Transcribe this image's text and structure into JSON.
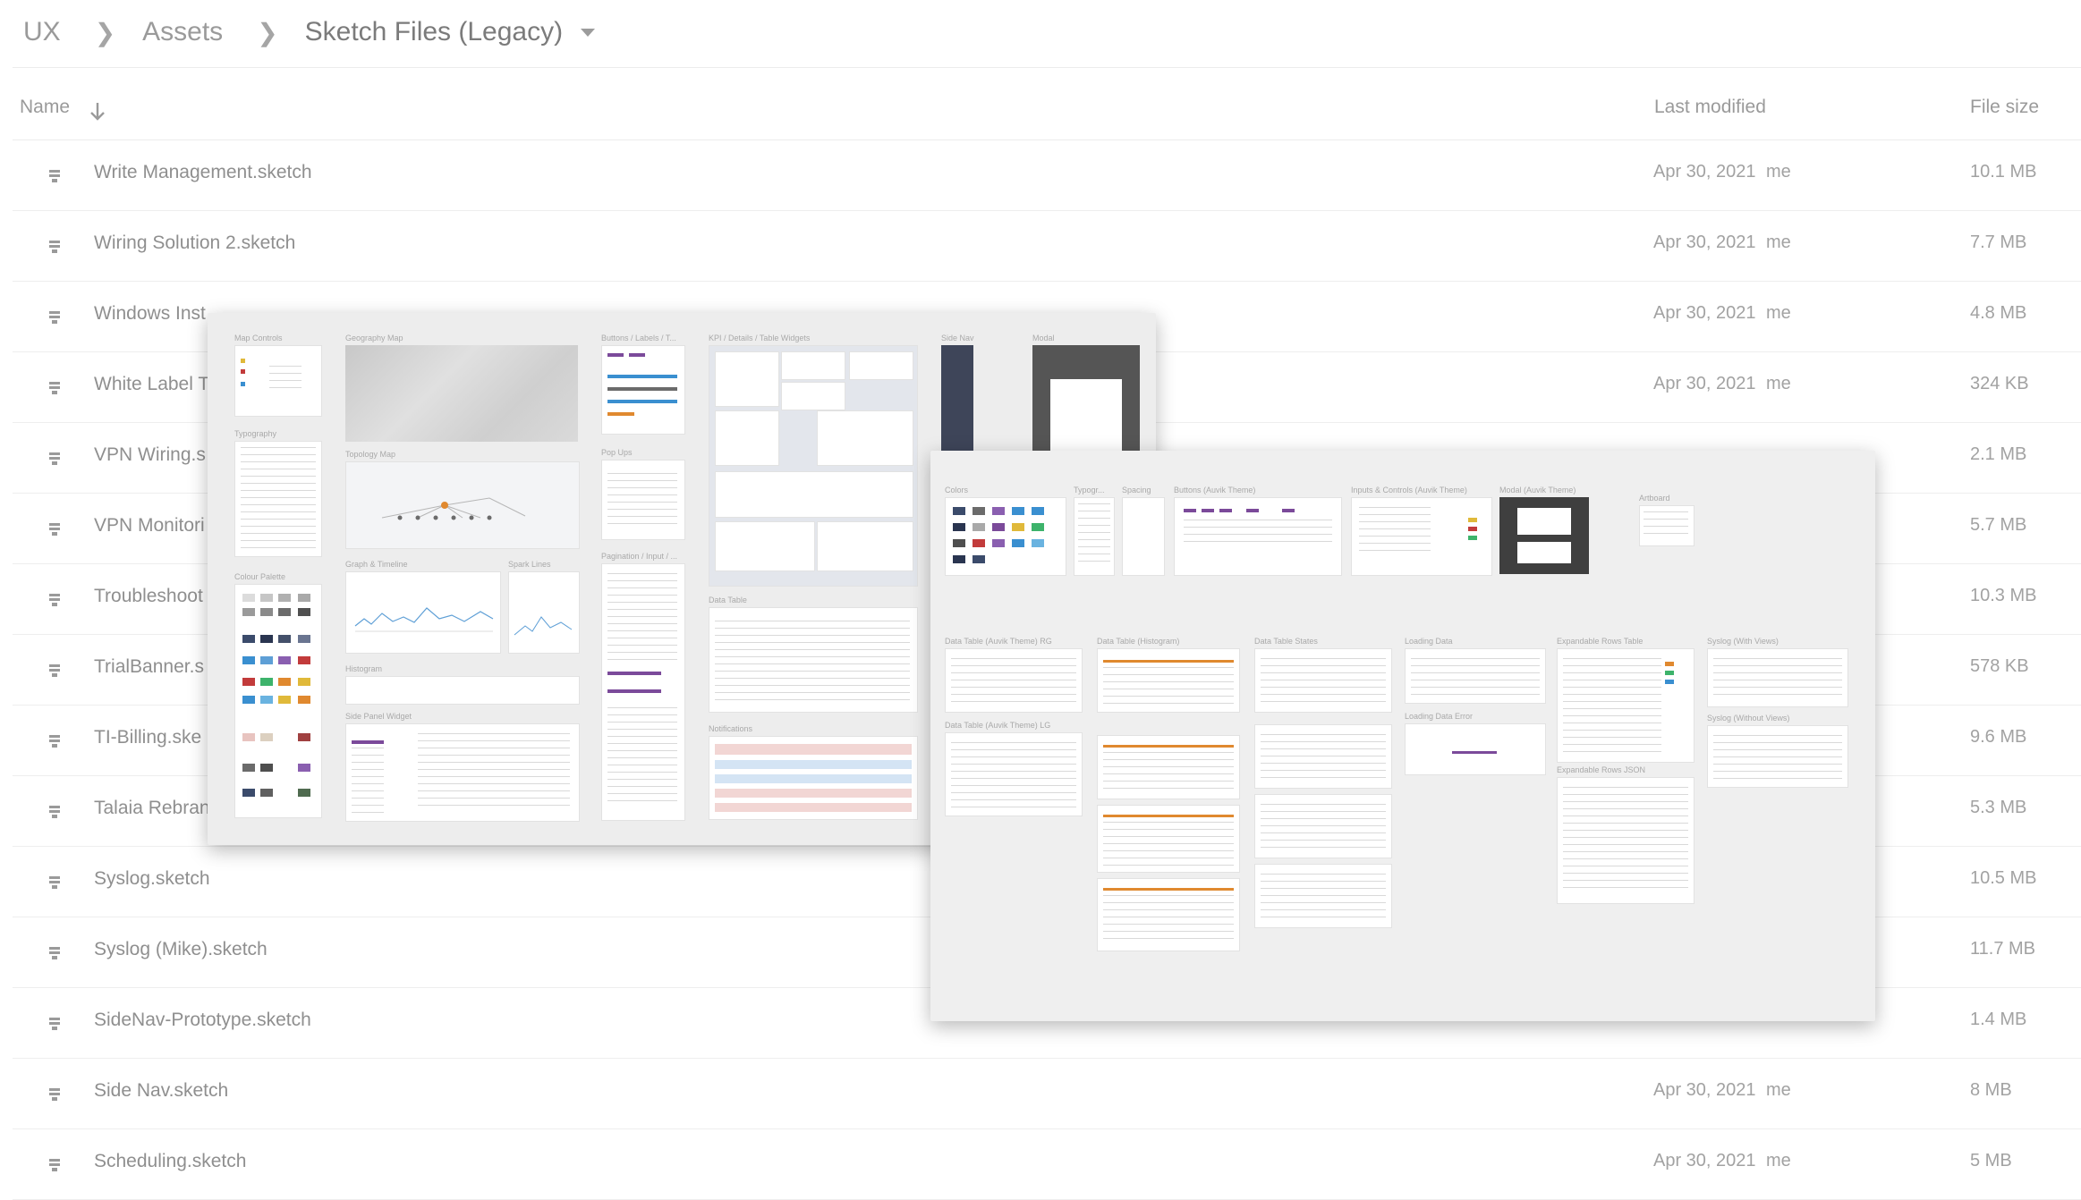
{
  "breadcrumb": {
    "items": [
      "UX",
      "Assets"
    ],
    "current": "Sketch Files (Legacy)"
  },
  "table": {
    "col_name": "Name",
    "col_modified": "Last modified",
    "col_size": "File size",
    "rows": [
      {
        "name": "Write Management.sketch",
        "date": "Apr 30, 2021",
        "owner": "me",
        "size": "10.1 MB"
      },
      {
        "name": "Wiring Solution 2.sketch",
        "date": "Apr 30, 2021",
        "owner": "me",
        "size": "7.7 MB"
      },
      {
        "name": "Windows Inst",
        "date": "Apr 30, 2021",
        "owner": "me",
        "size": "4.8 MB"
      },
      {
        "name": "White Label T",
        "date": "Apr 30, 2021",
        "owner": "me",
        "size": "324 KB"
      },
      {
        "name": "VPN Wiring.s",
        "date": "",
        "owner": "",
        "size": "2.1 MB"
      },
      {
        "name": "VPN Monitori",
        "date": "",
        "owner": "",
        "size": "5.7 MB"
      },
      {
        "name": "Troubleshoot",
        "date": "",
        "owner": "",
        "size": "10.3 MB"
      },
      {
        "name": "TrialBanner.s",
        "date": "",
        "owner": "",
        "size": "578 KB"
      },
      {
        "name": "TI-Billing.ske",
        "date": "",
        "owner": "",
        "size": "9.6 MB"
      },
      {
        "name": "Talaia Rebran",
        "date": "",
        "owner": "",
        "size": "5.3 MB"
      },
      {
        "name": "Syslog.sketch",
        "date": "",
        "owner": "",
        "size": "10.5 MB"
      },
      {
        "name": "Syslog (Mike).sketch",
        "date": "",
        "owner": "",
        "size": "11.7 MB"
      },
      {
        "name": "SideNav-Prototype.sketch",
        "date": "",
        "owner": "",
        "size": "1.4 MB"
      },
      {
        "name": "Side Nav.sketch",
        "date": "Apr 30, 2021",
        "owner": "me",
        "size": "8 MB"
      },
      {
        "name": "Scheduling.sketch",
        "date": "Apr 30, 2021",
        "owner": "me",
        "size": "5 MB"
      }
    ]
  },
  "overlay_left": {
    "labels": {
      "map_controls": "Map Controls",
      "geography_map": "Geography Map",
      "buttons_labels": "Buttons / Labels / T...",
      "kpi_widgets": "KPI / Details / Table Widgets",
      "side_nav": "Side Nav",
      "modal": "Modal",
      "typography": "Typography",
      "topology_map": "Topology Map",
      "pop_ups": "Pop Ups",
      "colour_palette": "Colour Palette",
      "graph_timeline": "Graph & Timeline",
      "spark_lines": "Spark Lines",
      "pagination_input": "Pagination / Input / ...",
      "histogram": "Histogram",
      "data_table": "Data Table",
      "side_panel_widget": "Side Panel Widget",
      "notifications": "Notifications"
    }
  },
  "overlay_right": {
    "labels": {
      "colors": "Colors",
      "typography": "Typogr...",
      "spacing": "Spacing",
      "buttons_auvik": "Buttons (Auvik Theme)",
      "inputs_auvik": "Inputs & Controls (Auvik Theme)",
      "modal_auvik": "Modal (Auvik Theme)",
      "artboard": "Artboard",
      "dt_rg": "Data Table (Auvik Theme) RG",
      "dt_histogram": "Data Table (Histogram)",
      "dt_states": "Data Table States",
      "loading_data": "Loading Data",
      "expandable_rows_table": "Expandable Rows Table",
      "syslog_with_views": "Syslog (With Views)",
      "dt_lg": "Data Table (Auvik Theme) LG",
      "loading_data_error": "Loading Data Error",
      "syslog_without_views": "Syslog (Without Views)",
      "expandable_rows_json": "Expandable Rows JSON"
    }
  },
  "colors": {
    "accent_purple": "#7b4a9a",
    "dark_nav": "#3e4559",
    "palette": [
      "#a9a9a9",
      "#6b6b6b",
      "#3b4b6b",
      "#2a3550",
      "#c23b3b",
      "#e0892f",
      "#3a8fd0",
      "#3db36b",
      "#e0b93a",
      "#8a5fb0",
      "#e8c4c0",
      "#4f6b4f"
    ]
  }
}
